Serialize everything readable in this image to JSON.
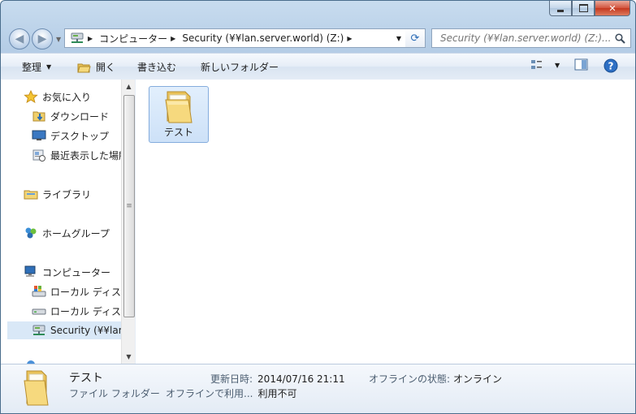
{
  "window": {
    "controls": {
      "minimize": "minimize",
      "maximize": "maximize",
      "close": "close"
    }
  },
  "nav": {
    "address": {
      "segments": [
        "コンピューター",
        "Security (¥¥lan.server.world) (Z:)"
      ]
    },
    "search": {
      "placeholder": "Security (¥¥lan.server.world) (Z:)..."
    }
  },
  "toolbar": {
    "organize": "整理",
    "open": "開く",
    "burn": "書き込む",
    "new_folder": "新しいフォルダー"
  },
  "sidebar": {
    "favorites": {
      "label": "お気に入り",
      "items": [
        "ダウンロード",
        "デスクトップ",
        "最近表示した場所"
      ]
    },
    "libraries": {
      "label": "ライブラリ"
    },
    "homegroup": {
      "label": "ホームグループ"
    },
    "computer": {
      "label": "コンピューター",
      "items": [
        "ローカル ディスク",
        "ローカル ディスク",
        "Security (¥¥lan.server.world) (Z:)"
      ]
    }
  },
  "main": {
    "items": [
      {
        "name": "テスト",
        "type": "folder",
        "selected": true
      }
    ]
  },
  "details": {
    "name": "テスト",
    "type": "ファイル フォルダー",
    "modified_label": "更新日時:",
    "modified_value": "2014/07/16 21:11",
    "offline_status_label": "オフラインの状態:",
    "offline_status_value": "オンライン",
    "offline_avail_label": "オフラインで利用...",
    "offline_avail_value": "利用不可"
  },
  "colors": {
    "selection": "#cde1f8",
    "selection_border": "#84acdd",
    "frame": "#b5cde6"
  }
}
